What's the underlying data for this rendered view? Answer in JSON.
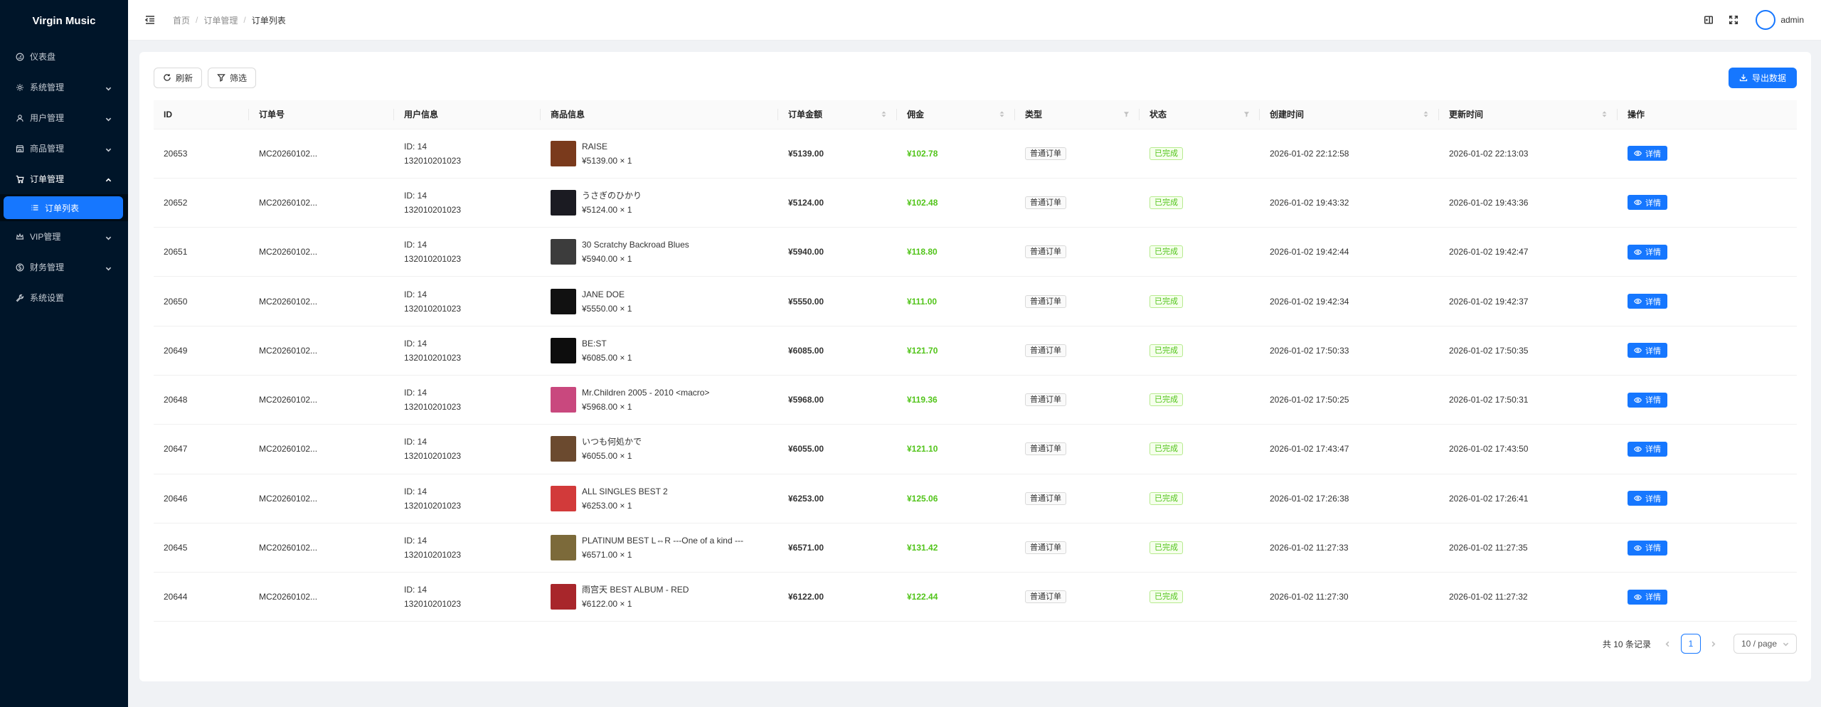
{
  "app": {
    "title": "Virgin Music"
  },
  "sidebar": {
    "items": [
      {
        "label": "仪表盘",
        "icon": "dashboard-icon",
        "has_children": false
      },
      {
        "label": "系统管理",
        "icon": "gear-icon",
        "has_children": true
      },
      {
        "label": "用户管理",
        "icon": "user-icon",
        "has_children": true
      },
      {
        "label": "商品管理",
        "icon": "shop-icon",
        "has_children": true
      },
      {
        "label": "订单管理",
        "icon": "cart-icon",
        "has_children": true,
        "open": true,
        "children": [
          {
            "label": "订单列表",
            "icon": "list-icon",
            "active": true
          }
        ]
      },
      {
        "label": "VIP管理",
        "icon": "crown-icon",
        "has_children": true
      },
      {
        "label": "财务管理",
        "icon": "money-icon",
        "has_children": true
      },
      {
        "label": "系统设置",
        "icon": "tool-icon",
        "has_children": false
      }
    ]
  },
  "header": {
    "breadcrumb": [
      "首页",
      "订单管理",
      "订单列表"
    ],
    "username": "admin"
  },
  "toolbar": {
    "refresh_label": "刷新",
    "filter_label": "筛选",
    "export_label": "导出数据"
  },
  "table": {
    "columns": [
      "ID",
      "订单号",
      "用户信息",
      "商品信息",
      "订单金额",
      "佣金",
      "类型",
      "状态",
      "创建时间",
      "更新时间",
      "操作"
    ],
    "detail_label": "详情",
    "rows": [
      {
        "id": "20653",
        "order_no": "MC20260102...",
        "user_id": "ID: 14",
        "user_phone": "132010201023",
        "goods_name": "RAISE",
        "goods_price": "¥5139.00 × 1",
        "amount": "¥5139.00",
        "commission": "¥102.78",
        "type": "普通订单",
        "status": "已完成",
        "created": "2026-01-02 22:12:58",
        "updated": "2026-01-02 22:13:03",
        "thumb": "#7a3a1c"
      },
      {
        "id": "20652",
        "order_no": "MC20260102...",
        "user_id": "ID: 14",
        "user_phone": "132010201023",
        "goods_name": "うさぎのひかり",
        "goods_price": "¥5124.00 × 1",
        "amount": "¥5124.00",
        "commission": "¥102.48",
        "type": "普通订单",
        "status": "已完成",
        "created": "2026-01-02 19:43:32",
        "updated": "2026-01-02 19:43:36",
        "thumb": "#1b1b22"
      },
      {
        "id": "20651",
        "order_no": "MC20260102...",
        "user_id": "ID: 14",
        "user_phone": "132010201023",
        "goods_name": "30 Scratchy Backroad Blues",
        "goods_price": "¥5940.00 × 1",
        "amount": "¥5940.00",
        "commission": "¥118.80",
        "type": "普通订单",
        "status": "已完成",
        "created": "2026-01-02 19:42:44",
        "updated": "2026-01-02 19:42:47",
        "thumb": "#3c3c3c"
      },
      {
        "id": "20650",
        "order_no": "MC20260102...",
        "user_id": "ID: 14",
        "user_phone": "132010201023",
        "goods_name": "JANE DOE",
        "goods_price": "¥5550.00 × 1",
        "amount": "¥5550.00",
        "commission": "¥111.00",
        "type": "普通订单",
        "status": "已完成",
        "created": "2026-01-02 19:42:34",
        "updated": "2026-01-02 19:42:37",
        "thumb": "#111111"
      },
      {
        "id": "20649",
        "order_no": "MC20260102...",
        "user_id": "ID: 14",
        "user_phone": "132010201023",
        "goods_name": "BE:ST",
        "goods_price": "¥6085.00 × 1",
        "amount": "¥6085.00",
        "commission": "¥121.70",
        "type": "普通订单",
        "status": "已完成",
        "created": "2026-01-02 17:50:33",
        "updated": "2026-01-02 17:50:35",
        "thumb": "#0d0d0d"
      },
      {
        "id": "20648",
        "order_no": "MC20260102...",
        "user_id": "ID: 14",
        "user_phone": "132010201023",
        "goods_name": "Mr.Children 2005 - 2010 <macro>",
        "goods_price": "¥5968.00 × 1",
        "amount": "¥5968.00",
        "commission": "¥119.36",
        "type": "普通订单",
        "status": "已完成",
        "created": "2026-01-02 17:50:25",
        "updated": "2026-01-02 17:50:31",
        "thumb": "#c9487e"
      },
      {
        "id": "20647",
        "order_no": "MC20260102...",
        "user_id": "ID: 14",
        "user_phone": "132010201023",
        "goods_name": "いつも何処かで",
        "goods_price": "¥6055.00 × 1",
        "amount": "¥6055.00",
        "commission": "¥121.10",
        "type": "普通订单",
        "status": "已完成",
        "created": "2026-01-02 17:43:47",
        "updated": "2026-01-02 17:43:50",
        "thumb": "#6b4a2f"
      },
      {
        "id": "20646",
        "order_no": "MC20260102...",
        "user_id": "ID: 14",
        "user_phone": "132010201023",
        "goods_name": "ALL SINGLES BEST 2",
        "goods_price": "¥6253.00 × 1",
        "amount": "¥6253.00",
        "commission": "¥125.06",
        "type": "普通订单",
        "status": "已完成",
        "created": "2026-01-02 17:26:38",
        "updated": "2026-01-02 17:26:41",
        "thumb": "#d23a3a"
      },
      {
        "id": "20645",
        "order_no": "MC20260102...",
        "user_id": "ID: 14",
        "user_phone": "132010201023",
        "goods_name": "PLATINUM BEST L⇔R ---One of a kind ---",
        "goods_price": "¥6571.00 × 1",
        "amount": "¥6571.00",
        "commission": "¥131.42",
        "type": "普通订单",
        "status": "已完成",
        "created": "2026-01-02 11:27:33",
        "updated": "2026-01-02 11:27:35",
        "thumb": "#7c6a3a"
      },
      {
        "id": "20644",
        "order_no": "MC20260102...",
        "user_id": "ID: 14",
        "user_phone": "132010201023",
        "goods_name": "雨宫天 BEST ALBUM - RED",
        "goods_price": "¥6122.00 × 1",
        "amount": "¥6122.00",
        "commission": "¥122.44",
        "type": "普通订单",
        "status": "已完成",
        "created": "2026-01-02 11:27:30",
        "updated": "2026-01-02 11:27:32",
        "thumb": "#a8262b"
      }
    ]
  },
  "pagination": {
    "total_text": "共 10 条记录",
    "current_page": "1",
    "page_size": "10 / page"
  }
}
